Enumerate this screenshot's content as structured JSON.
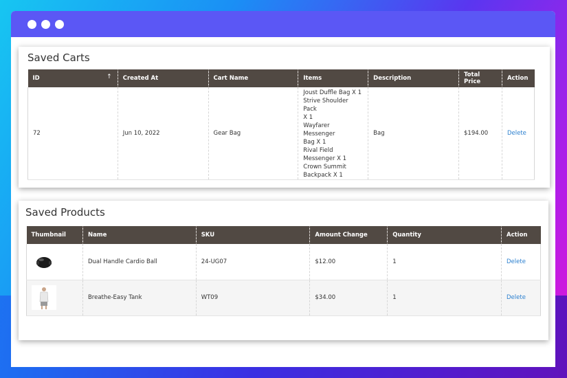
{
  "saved_carts": {
    "title": "Saved Carts",
    "columns": [
      "ID",
      "Created At",
      "Cart Name",
      "Items",
      "Description",
      "Total Price",
      "Action"
    ],
    "sort_indicator": "↑",
    "rows": [
      {
        "id": "72",
        "created_at": "Jun 10, 2022",
        "cart_name": "Gear Bag",
        "items": [
          "Joust Duffle Bag X 1",
          "Strive Shoulder Pack",
          "X 1",
          "Wayfarer Messenger",
          "Bag X 1",
          "Rival Field",
          "Messenger X 1",
          "Crown Summit",
          "Backpack X 1"
        ],
        "description": "Bag",
        "total_price": "$194.00",
        "action": "Delete"
      }
    ]
  },
  "saved_products": {
    "title": "Saved Products",
    "columns": [
      "Thumbnail",
      "Name",
      "SKU",
      "Amount Change",
      "Quantity",
      "Action"
    ],
    "rows": [
      {
        "thumbnail": "cardio-ball-thumbnail",
        "name": "Dual Handle Cardio Ball",
        "sku": "24-UG07",
        "amount_change": "$12.00",
        "quantity": "1",
        "action": "Delete"
      },
      {
        "thumbnail": "tank-top-thumbnail",
        "name": "Breathe-Easy Tank",
        "sku": "WT09",
        "amount_change": "$34.00",
        "quantity": "1",
        "action": "Delete"
      }
    ]
  },
  "colors": {
    "titlebar": "#5b57f5",
    "table_header": "#514943",
    "link": "#2a7fcf"
  }
}
